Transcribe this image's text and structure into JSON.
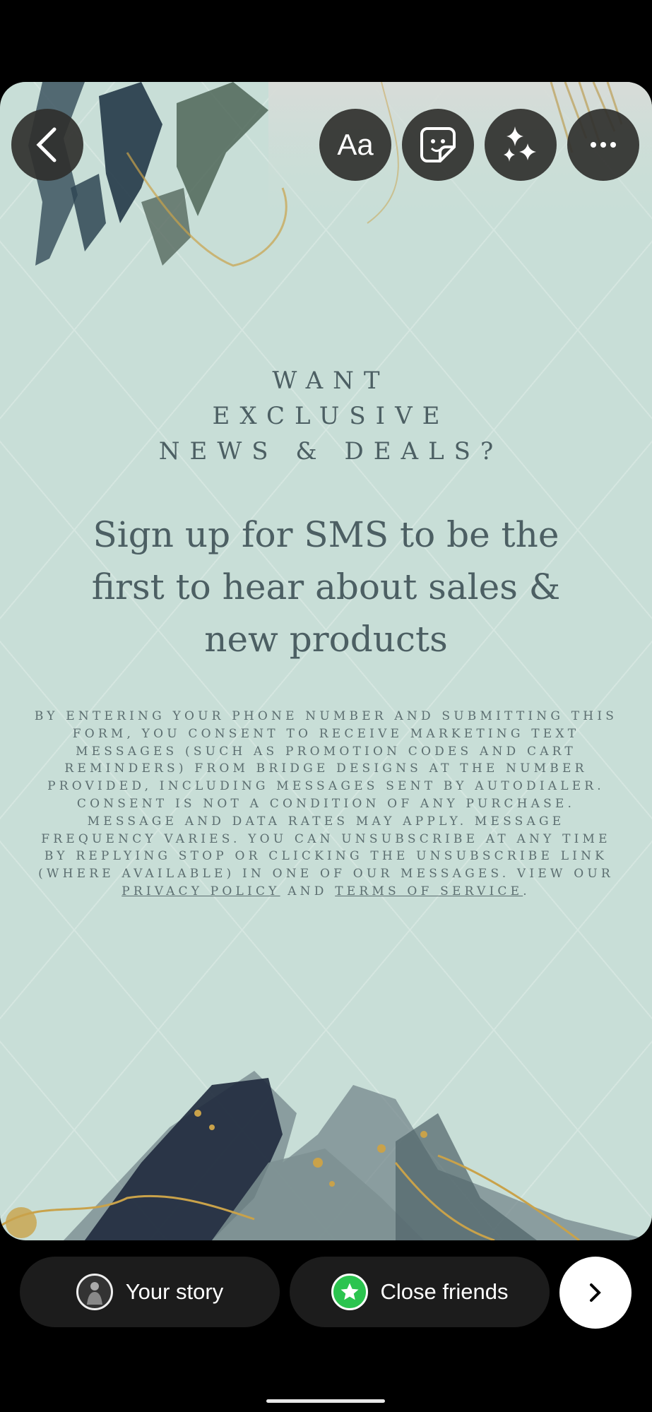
{
  "toolbar": {
    "back": "back",
    "text_tool": "Aa",
    "sticker": "sticker",
    "effects": "effects",
    "more": "more"
  },
  "story": {
    "heading_lines": [
      "WANT",
      "EXCLUSIVE",
      "NEWS & DEALS?"
    ],
    "subheading": "Sign up for SMS to be the first to hear about sales & new products",
    "legal_text": "By entering your phone number and submitting this form, you consent to receive marketing text messages (such as promotion codes and cart reminders) from Bridge Designs at the number provided, including messages sent by autodialer. Consent is not a condition of any purchase. Message and data rates may apply. Message frequency varies. You can unsubscribe at any time by replying STOP or clicking the unsubscribe link (where available) in one of our messages. View our",
    "privacy_link": "Privacy Policy",
    "and_text": "and",
    "terms_link": "Terms of Service",
    "period": "."
  },
  "share": {
    "your_story": "Your story",
    "close_friends": "Close friends",
    "close_friends_color": "#2bc44f",
    "next": "next"
  },
  "colors": {
    "card_bg": "#c8ded7",
    "text": "#4c5f63"
  }
}
